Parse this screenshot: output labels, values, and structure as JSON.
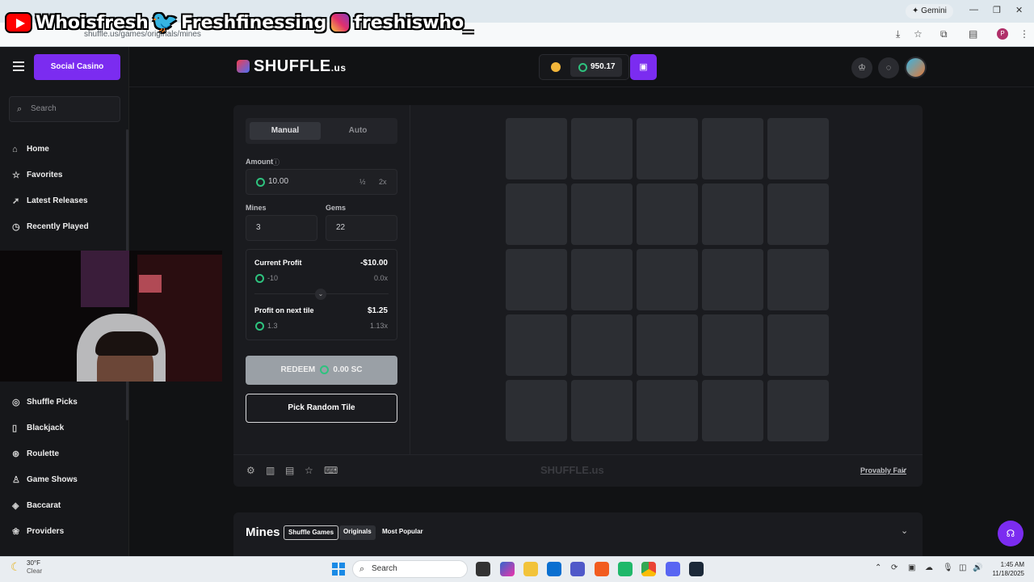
{
  "overlay": {
    "youtube": "Whoisfresh",
    "twitter": "Freshfinessing",
    "instagram": "freshiswho_"
  },
  "browser": {
    "url": "shuffle.us/games/originals/mines",
    "gemini": "Gemini",
    "profile": "P"
  },
  "header": {
    "brand": "SHUFFLE",
    "brand_suffix": ".us",
    "balance": "950.17"
  },
  "sidebar": {
    "casino_button": "Social Casino",
    "search_placeholder": "Search",
    "items_top": [
      {
        "label": "Home",
        "icon": "home-icon"
      },
      {
        "label": "Favorites",
        "icon": "star-icon"
      },
      {
        "label": "Latest Releases",
        "icon": "rocket-icon"
      },
      {
        "label": "Recently Played",
        "icon": "clock-icon"
      }
    ],
    "items_bottom": [
      {
        "label": "Shuffle Picks",
        "icon": "picks-icon"
      },
      {
        "label": "Blackjack",
        "icon": "cards-icon"
      },
      {
        "label": "Roulette",
        "icon": "roulette-icon"
      },
      {
        "label": "Game Shows",
        "icon": "host-icon"
      },
      {
        "label": "Baccarat",
        "icon": "baccarat-icon"
      },
      {
        "label": "Providers",
        "icon": "providers-icon"
      }
    ]
  },
  "game": {
    "tabs": {
      "manual": "Manual",
      "auto": "Auto"
    },
    "amount_label": "Amount",
    "amount_value": "10.00",
    "half": "½",
    "double": "2x",
    "mines_label": "Mines",
    "mines_value": "3",
    "gems_label": "Gems",
    "gems_value": "22",
    "current_profit_label": "Current Profit",
    "current_profit_value": "-$10.00",
    "current_profit_coins": "-10",
    "current_profit_mult": "0.0x",
    "next_tile_label": "Profit on next tile",
    "next_tile_value": "$1.25",
    "next_tile_coins": "1.3",
    "next_tile_mult": "1.13x",
    "redeem_label": "REDEEM",
    "redeem_amount": "0.00 SC",
    "pick_random": "Pick Random Tile",
    "watermark": "SHUFFLE.us",
    "provably_fair": "Provably Fair"
  },
  "section": {
    "title": "Mines",
    "chips": [
      "Shuffle Games",
      "Originals",
      "Most Popular"
    ]
  },
  "taskbar": {
    "temp": "30°F",
    "condition": "Clear",
    "search": "Search",
    "time": "1:45 AM",
    "date": "11/18/2025"
  },
  "colors": {
    "accent": "#7b2cf0",
    "coin_green": "#2ec27e",
    "tile": "#2c2e33"
  }
}
